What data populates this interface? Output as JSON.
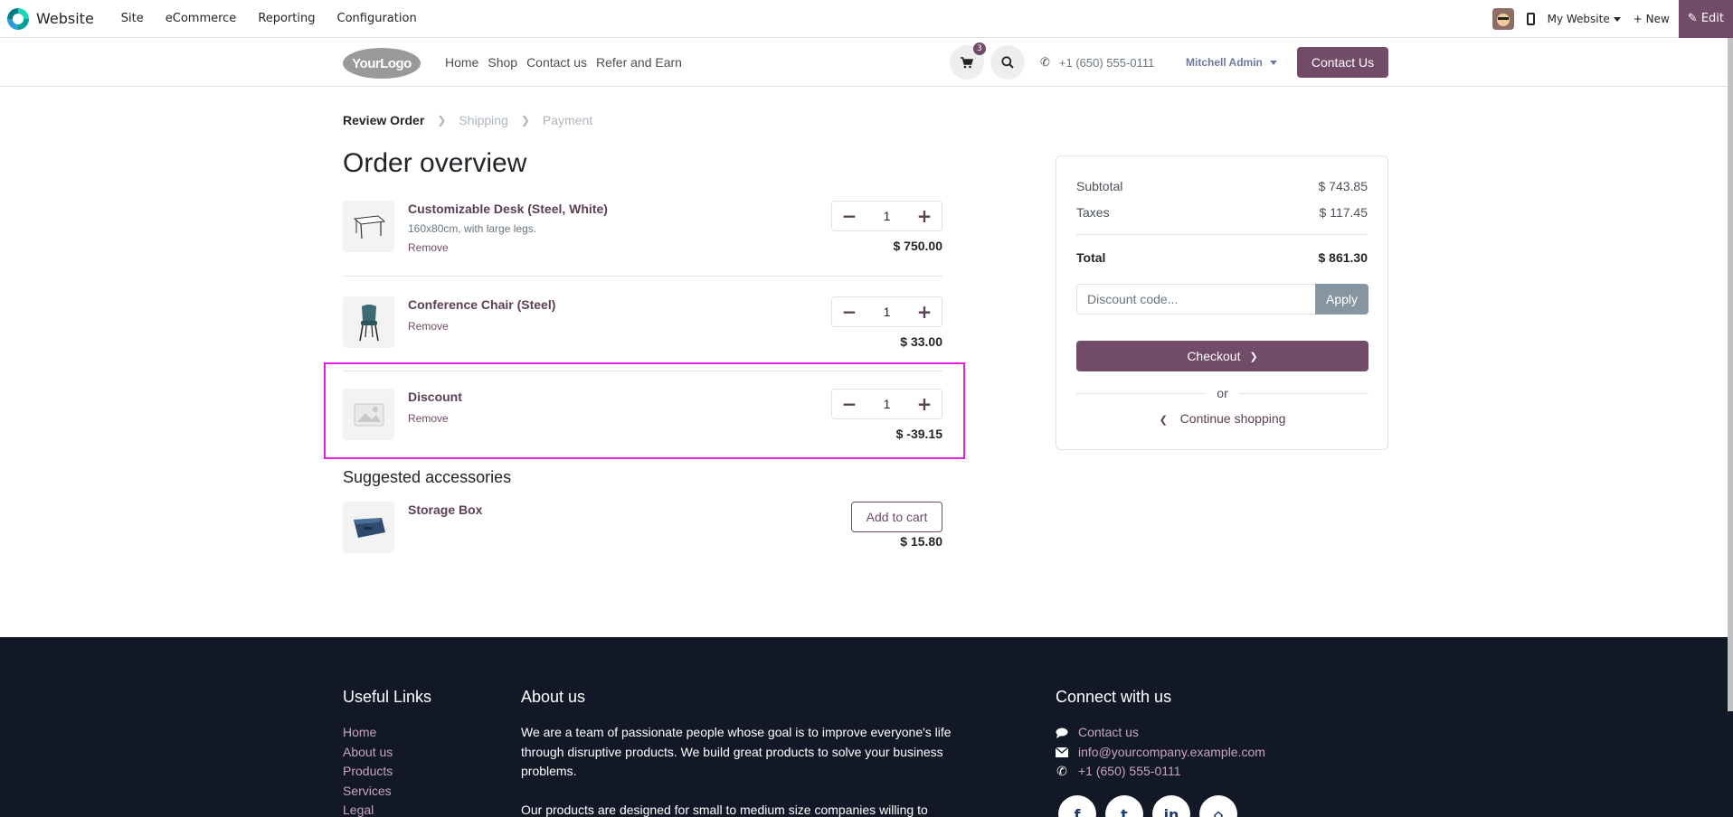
{
  "admin": {
    "brand": "Website",
    "menu": [
      "Site",
      "eCommerce",
      "Reporting",
      "Configuration"
    ],
    "my_website": "My Website",
    "new_label": "+ New",
    "edit_label": "Edit"
  },
  "header": {
    "logo_text": "YourLogo",
    "nav": [
      "Home",
      "Shop",
      "Contact us",
      "Refer and Earn"
    ],
    "cart_count": "3",
    "phone": "+1 (650) 555-0111",
    "user": "Mitchell Admin",
    "contact_button": "Contact Us"
  },
  "breadcrumb": {
    "steps": [
      "Review Order",
      "Shipping",
      "Payment"
    ]
  },
  "page_title": "Order overview",
  "lines": [
    {
      "name": "Customizable Desk (Steel, White)",
      "desc": "160x80cm, with large legs.",
      "remove": "Remove",
      "qty": "1",
      "price": "$ 750.00"
    },
    {
      "name": "Conference Chair (Steel)",
      "desc": "",
      "remove": "Remove",
      "qty": "1",
      "price": "$ 33.00"
    },
    {
      "name": "Discount",
      "desc": "",
      "remove": "Remove",
      "qty": "1",
      "price": "$ -39.15"
    }
  ],
  "suggested": {
    "title": "Suggested accessories",
    "items": [
      {
        "name": "Storage Box",
        "button": "Add to cart",
        "price": "$ 15.80"
      }
    ]
  },
  "summary": {
    "subtotal_label": "Subtotal",
    "subtotal": "$ 743.85",
    "taxes_label": "Taxes",
    "taxes": "$ 117.45",
    "total_label": "Total",
    "total": "$ 861.30",
    "discount_placeholder": "Discount code...",
    "apply": "Apply",
    "checkout": "Checkout",
    "or": "or",
    "continue": "Continue shopping"
  },
  "footer": {
    "links_title": "Useful Links",
    "links": [
      "Home",
      "About us",
      "Products",
      "Services",
      "Legal"
    ],
    "about_title": "About us",
    "about_p1": "We are a team of passionate people whose goal is to improve everyone's life through disruptive products. We build great products to solve your business problems.",
    "about_p2": "Our products are designed for small to medium size companies willing to",
    "connect_title": "Connect with us",
    "contact_us": "Contact us",
    "email": "info@yourcompany.example.com",
    "phone": "+1 (650) 555-0111"
  },
  "colors": {
    "brand": "#714b67",
    "footer_bg": "#121826",
    "highlight": "#e91ee3"
  }
}
